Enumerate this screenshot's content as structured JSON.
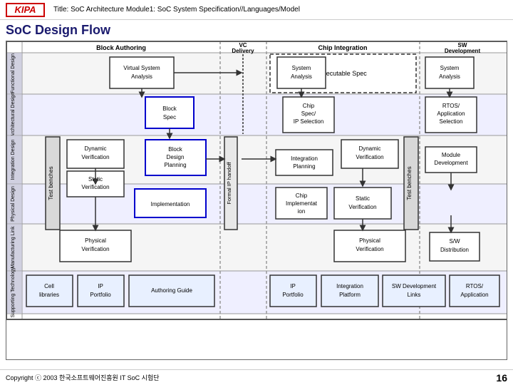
{
  "header": {
    "logo_text": "KIPA",
    "title": "Title: SoC Architecture  Module1: SoC System Specification//Languages/Model"
  },
  "page_title": "SoC Design Flow",
  "footer": {
    "copyright": "Copyright ⓒ 2003   한국소프트웨어진흥원  IT SoC 시험단",
    "page_num": "16"
  },
  "diagram": {
    "col_headers": [
      {
        "id": "block-authoring",
        "label": "Block Authoring"
      },
      {
        "id": "vc-delivery",
        "label": "VC\nDelivery"
      },
      {
        "id": "chip-integration",
        "label": "Chip Integration"
      },
      {
        "id": "sw-development",
        "label": "SW\nDevelopment"
      }
    ],
    "row_labels": [
      "Functional\nDesign",
      "Architectural\nDesign",
      "Integration\nDesign",
      "Physical\nDesign",
      "Manufacturing\nLink",
      "Supporting\nTechnology"
    ],
    "boxes": [
      {
        "id": "executable-spec",
        "label": "Executable Spec"
      },
      {
        "id": "virtual-system-analysis",
        "label": "Virtual System\nAnalysis"
      },
      {
        "id": "system-analysis-1",
        "label": "System\nAnalysis"
      },
      {
        "id": "system-analysis-2",
        "label": "System\nAnalysis"
      },
      {
        "id": "block-spec",
        "label": "Block\nSpec"
      },
      {
        "id": "chip-spec",
        "label": "Chip\nSpec/\nIP Selection"
      },
      {
        "id": "rtos-app",
        "label": "RTOS/\nApplication\nSelection"
      },
      {
        "id": "dynamic-verification-1",
        "label": "Dynamic\nVerification"
      },
      {
        "id": "block-design-planning",
        "label": "Block\nDesign\nPlanning"
      },
      {
        "id": "dynamic-verification-2",
        "label": "Dynamic\nVerification"
      },
      {
        "id": "module-development",
        "label": "Module\nDevelopment"
      },
      {
        "id": "static-verification-1",
        "label": "Static\nVerification"
      },
      {
        "id": "integration-planning",
        "label": "Integration\nPlanning"
      },
      {
        "id": "implementation",
        "label": "Implementation"
      },
      {
        "id": "chip-implementation",
        "label": "Chip\nImplementat\nion"
      },
      {
        "id": "static-verification-2",
        "label": "Static\nVerification"
      },
      {
        "id": "physical-verification-1",
        "label": "Physical\nVerification"
      },
      {
        "id": "physical-verification-2",
        "label": "Physical\nVerification"
      },
      {
        "id": "sw-distribution",
        "label": "S/W\nDistribution"
      },
      {
        "id": "cell-libraries",
        "label": "Cell\nlibraries"
      },
      {
        "id": "ip-portfolio-1",
        "label": "IP\nPortfolio"
      },
      {
        "id": "authoring-guide",
        "label": "Authoring Guide"
      },
      {
        "id": "ip-portfolio-2",
        "label": "IP\nPortfolio"
      },
      {
        "id": "integration-platform",
        "label": "Integration\nPlatform"
      },
      {
        "id": "sw-dev-links",
        "label": "SW Development\nLinks"
      },
      {
        "id": "rtos-application",
        "label": "RTOS/\nApplication"
      },
      {
        "id": "formal-ip-handoff",
        "label": "Formal IP handoff"
      },
      {
        "id": "test-benches-1",
        "label": "Test benches"
      },
      {
        "id": "test-benches-2",
        "label": "Test benches"
      }
    ]
  }
}
